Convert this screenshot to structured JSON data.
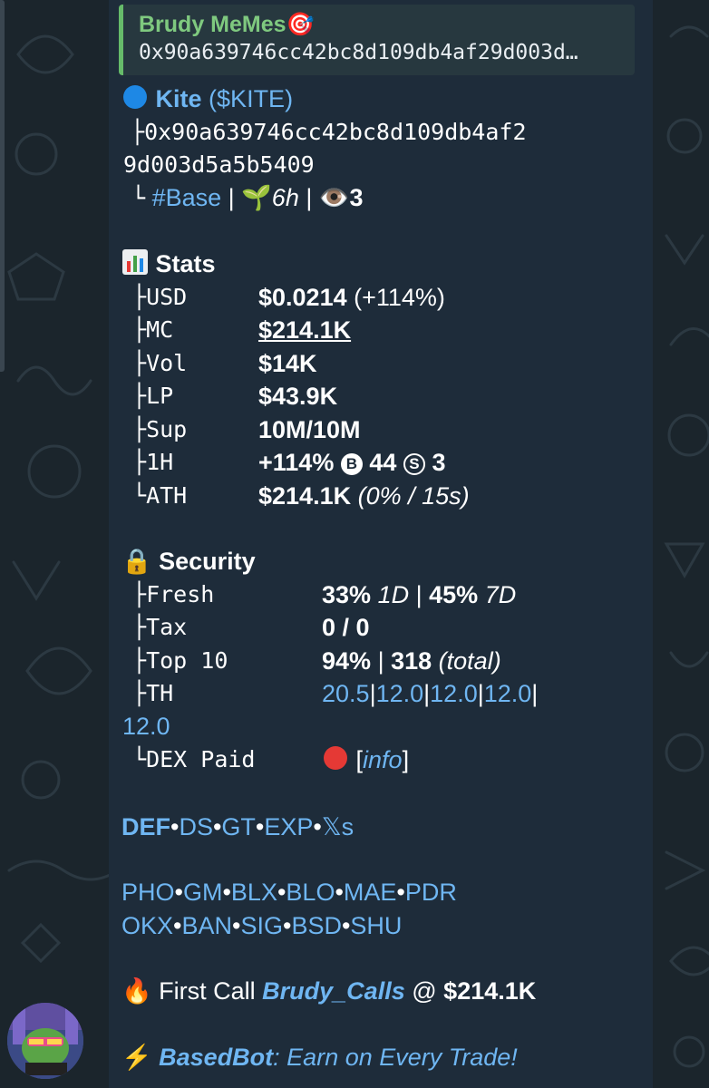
{
  "reply": {
    "name": "Brudy MeMes",
    "text": "0x90a639746cc42bc8d109db4af29d003d…"
  },
  "token": {
    "name": "Kite",
    "ticker": "($KITE)",
    "address_line1": "0x90a639746cc42bc8d109db4af2",
    "address_line2": "9d003d5a5b5409",
    "chain": "#Base",
    "age": "6h",
    "views": "3"
  },
  "stats": {
    "title": "Stats",
    "rows": [
      {
        "prefix": "├",
        "label": "USD",
        "value": "$0.0214",
        "extra": "(+114%)"
      },
      {
        "prefix": "├",
        "label": "MC",
        "value": "$214.1K"
      },
      {
        "prefix": "├",
        "label": "Vol",
        "value": "$14K"
      },
      {
        "prefix": "├",
        "label": "LP",
        "value": "$43.9K"
      },
      {
        "prefix": "├",
        "label": "Sup",
        "value": "10M/10M"
      },
      {
        "prefix": "├",
        "label": "1H",
        "value": "+114%",
        "buys": "44",
        "sells": "3",
        "buy_symbol": "B",
        "sell_symbol": "S"
      },
      {
        "prefix": "└",
        "label": "ATH",
        "value": "$214.1K",
        "extra": "(0% / 15s)"
      }
    ]
  },
  "security": {
    "title": "Security",
    "fresh": {
      "prefix": "├",
      "label": "Fresh",
      "v1": "33%",
      "v1_unit": "1D",
      "sep": "|",
      "v2": "45%",
      "v2_unit": "7D"
    },
    "tax": {
      "prefix": "├",
      "label": "Tax",
      "value": "0 / 0"
    },
    "top10": {
      "prefix": "├",
      "label": "Top 10",
      "value": "94%",
      "sep": "|",
      "holders": "318",
      "holders_note": "(total)"
    },
    "th": {
      "prefix": "├",
      "label": "TH",
      "values": [
        "20.5",
        "12.0",
        "12.0",
        "12.0",
        "12.0"
      ]
    },
    "dex": {
      "prefix": "└",
      "label": "DEX Paid",
      "info": "info"
    }
  },
  "links_row1": [
    "DEF",
    "DS",
    "GT",
    "EXP",
    "𝕏s"
  ],
  "links_row2": [
    "PHO",
    "GM",
    "BLX",
    "BLO",
    "MAE",
    "PDR"
  ],
  "links_row3": [
    "OKX",
    "BAN",
    "SIG",
    "BSD",
    "SHU"
  ],
  "first_call": {
    "label": "First Call",
    "caller": "Brudy_Calls",
    "at": "@",
    "value": "$214.1K"
  },
  "promo": {
    "bot": "BasedBot",
    "text": ": Earn on Every Trade!"
  },
  "colors": {
    "link": "#6fb6f2",
    "accent_green": "#66bb6a",
    "bubble": "#1e2c3a",
    "background": "#1b252c"
  }
}
